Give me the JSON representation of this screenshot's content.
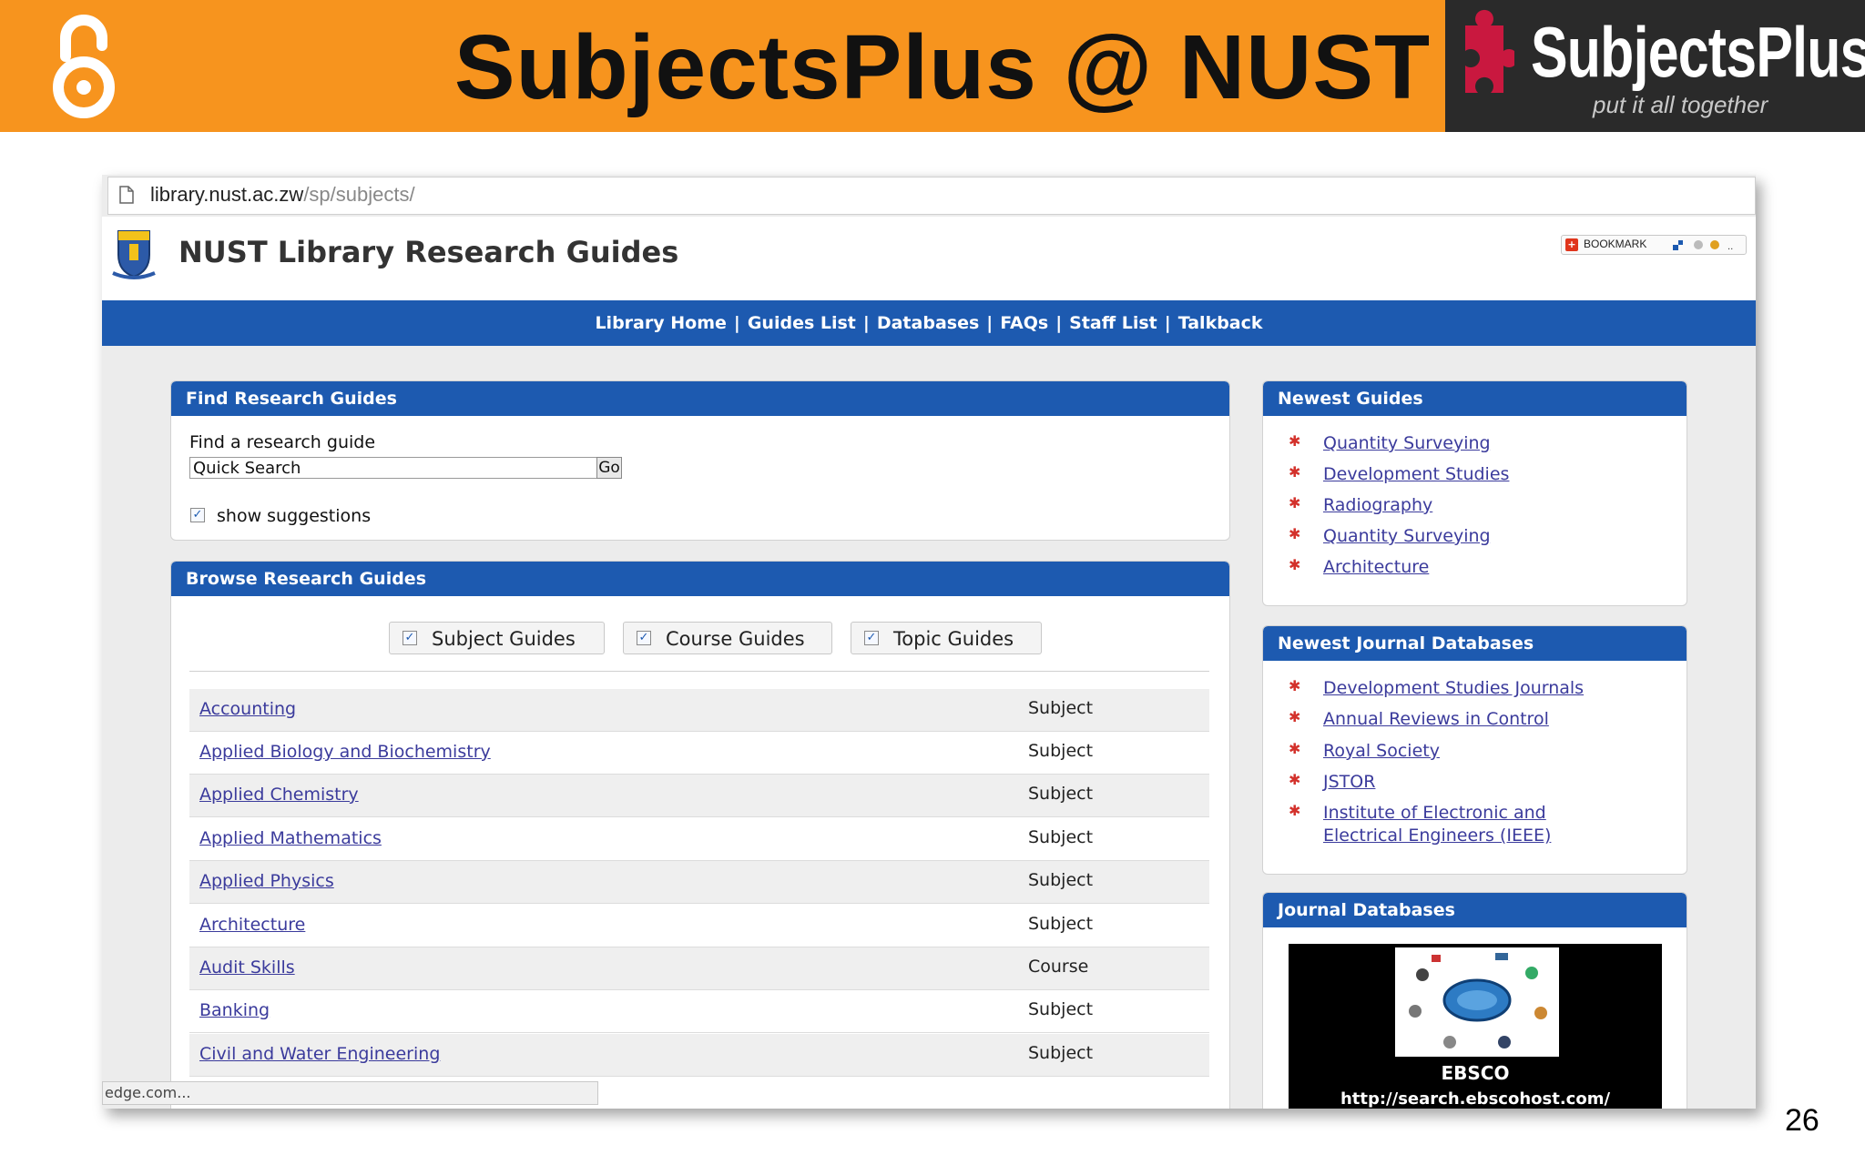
{
  "slide": {
    "title": "SubjectsPlus @ NUST",
    "logo_name": "SubjectsPlus",
    "logo_tagline": "put it all together",
    "page_number": "26",
    "accent_color": "#f7941e"
  },
  "browser": {
    "url_host": "library.nust.ac.zw",
    "url_path": "/sp/subjects/",
    "status_text": "edge.com..."
  },
  "site": {
    "title": "NUST Library Research Guides",
    "bookmark_label": "BOOKMARK",
    "brand_color": "#1d5ab0",
    "nav": [
      "Library Home",
      "Guides List",
      "Databases",
      "FAQs",
      "Staff List",
      "Talkback"
    ]
  },
  "find": {
    "header": "Find Research Guides",
    "label": "Find a research guide",
    "input_value": "Quick Search",
    "go_label": "Go",
    "suggest_label": "show suggestions"
  },
  "browse": {
    "header": "Browse Research Guides",
    "filters": [
      "Subject Guides",
      "Course Guides",
      "Topic Guides"
    ],
    "guides": [
      {
        "name": "Accounting",
        "type": "Subject"
      },
      {
        "name": "Applied Biology and Biochemistry",
        "type": "Subject"
      },
      {
        "name": "Applied Chemistry",
        "type": "Subject"
      },
      {
        "name": "Applied Mathematics",
        "type": "Subject"
      },
      {
        "name": "Applied Physics",
        "type": "Subject"
      },
      {
        "name": "Architecture",
        "type": "Subject"
      },
      {
        "name": "Audit Skills",
        "type": "Course"
      },
      {
        "name": "Banking",
        "type": "Subject"
      },
      {
        "name": "Civil and Water Engineering",
        "type": "Subject"
      }
    ]
  },
  "newest_guides": {
    "header": "Newest Guides",
    "items": [
      "Quantity Surveying",
      "Development Studies",
      "Radiography",
      "Quantity Surveying",
      "Architecture"
    ]
  },
  "newest_journals": {
    "header": "Newest Journal Databases",
    "items": [
      "Development Studies Journals",
      "Annual Reviews in Control",
      "Royal Society",
      "JSTOR",
      "Institute of Electronic and Electrical Engineers (IEEE)"
    ]
  },
  "journal_databases": {
    "header": "Journal Databases",
    "name": "EBSCO",
    "url": "http://search.ebscohost.com/"
  }
}
